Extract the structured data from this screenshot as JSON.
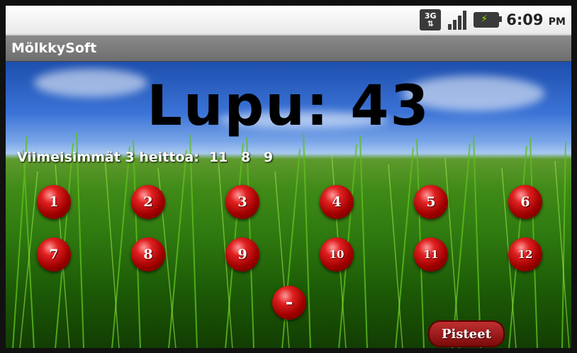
{
  "status_bar": {
    "network": "3G",
    "time": "6:09",
    "ampm": "PM"
  },
  "app": {
    "title": "MölkkySoft"
  },
  "score": {
    "text": "Lupu: 43"
  },
  "recent": {
    "label": "Viimeisimmät 3 heittoa:",
    "values": "11 8 9"
  },
  "buttons": {
    "row1": [
      "1",
      "2",
      "3",
      "4",
      "5",
      "6"
    ],
    "row2": [
      "7",
      "8",
      "9",
      "10",
      "11",
      "12"
    ],
    "minus": "-",
    "pisteet": "Pisteet"
  },
  "colors": {
    "ball_red": "#c01010",
    "title_bar": "#7a7a7a"
  }
}
